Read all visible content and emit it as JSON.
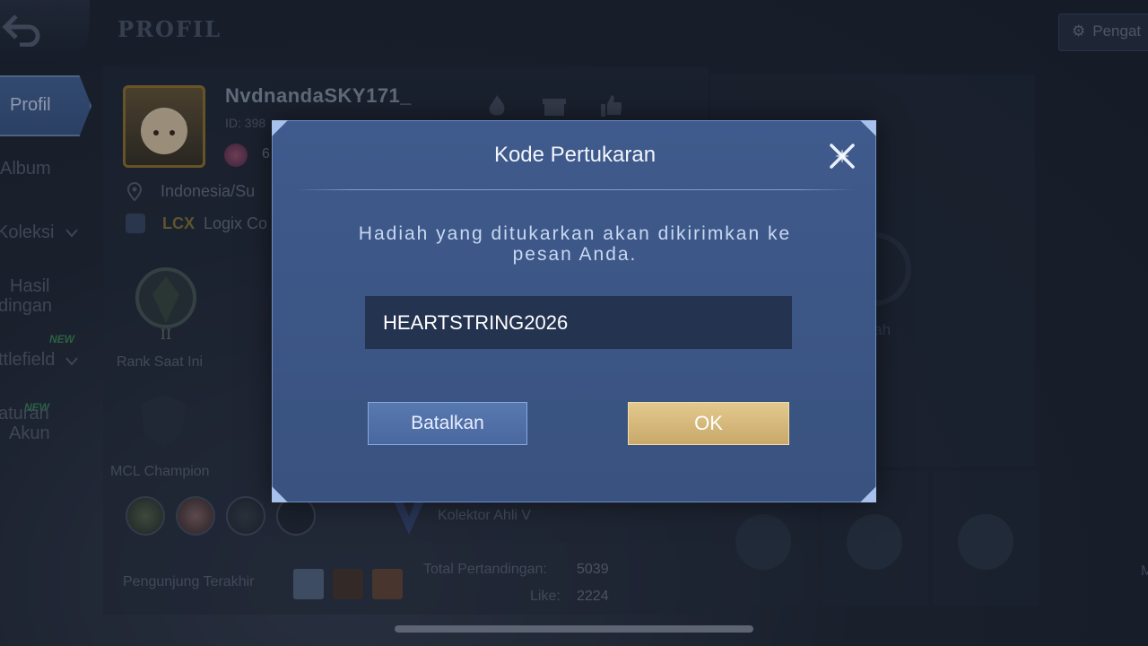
{
  "header": {
    "title": "PROFIL",
    "settings_label": "Pengat"
  },
  "nav": {
    "profil": "Profil",
    "album": "Album",
    "koleksi": "Koleksi",
    "hasil_line1": "Hasil",
    "hasil_line2": "dingan",
    "battlefield": "ttlefield",
    "pengaturan_line1": "aturan",
    "pengaturan_line2": "Akun",
    "new_badge_1": "NEW",
    "new_badge_2": "NEW"
  },
  "profile": {
    "username": "NvdnandaSKY171_",
    "id_prefix": "ID: 398",
    "level": "6",
    "location": "Indonesia/Su",
    "squad_tag": "LCX",
    "squad_name": "Logix Co"
  },
  "stats": {
    "rank_label": "Rank Saat Ini",
    "mcl_label": "MCL Champion",
    "collector_label": "Kolektor Ahli V",
    "visitors_label": "Pengunjung Terakhir",
    "total_label": "Total Pertandingan:",
    "total_value": "5039",
    "like_label": "Like:",
    "like_value": "2224"
  },
  "right_panel": {
    "text": "engunggah",
    "edge_text": "M"
  },
  "modal": {
    "title": "Kode Pertukaran",
    "message": "Hadiah yang ditukarkan akan dikirimkan ke pesan Anda.",
    "code_value": "HEARTSTRING2026",
    "cancel_label": "Batalkan",
    "ok_label": "OK"
  },
  "colors": {
    "modal_bg": "#3f5a8c",
    "ok_gold": "#d9bd80",
    "cancel_blue": "#5070a8"
  }
}
